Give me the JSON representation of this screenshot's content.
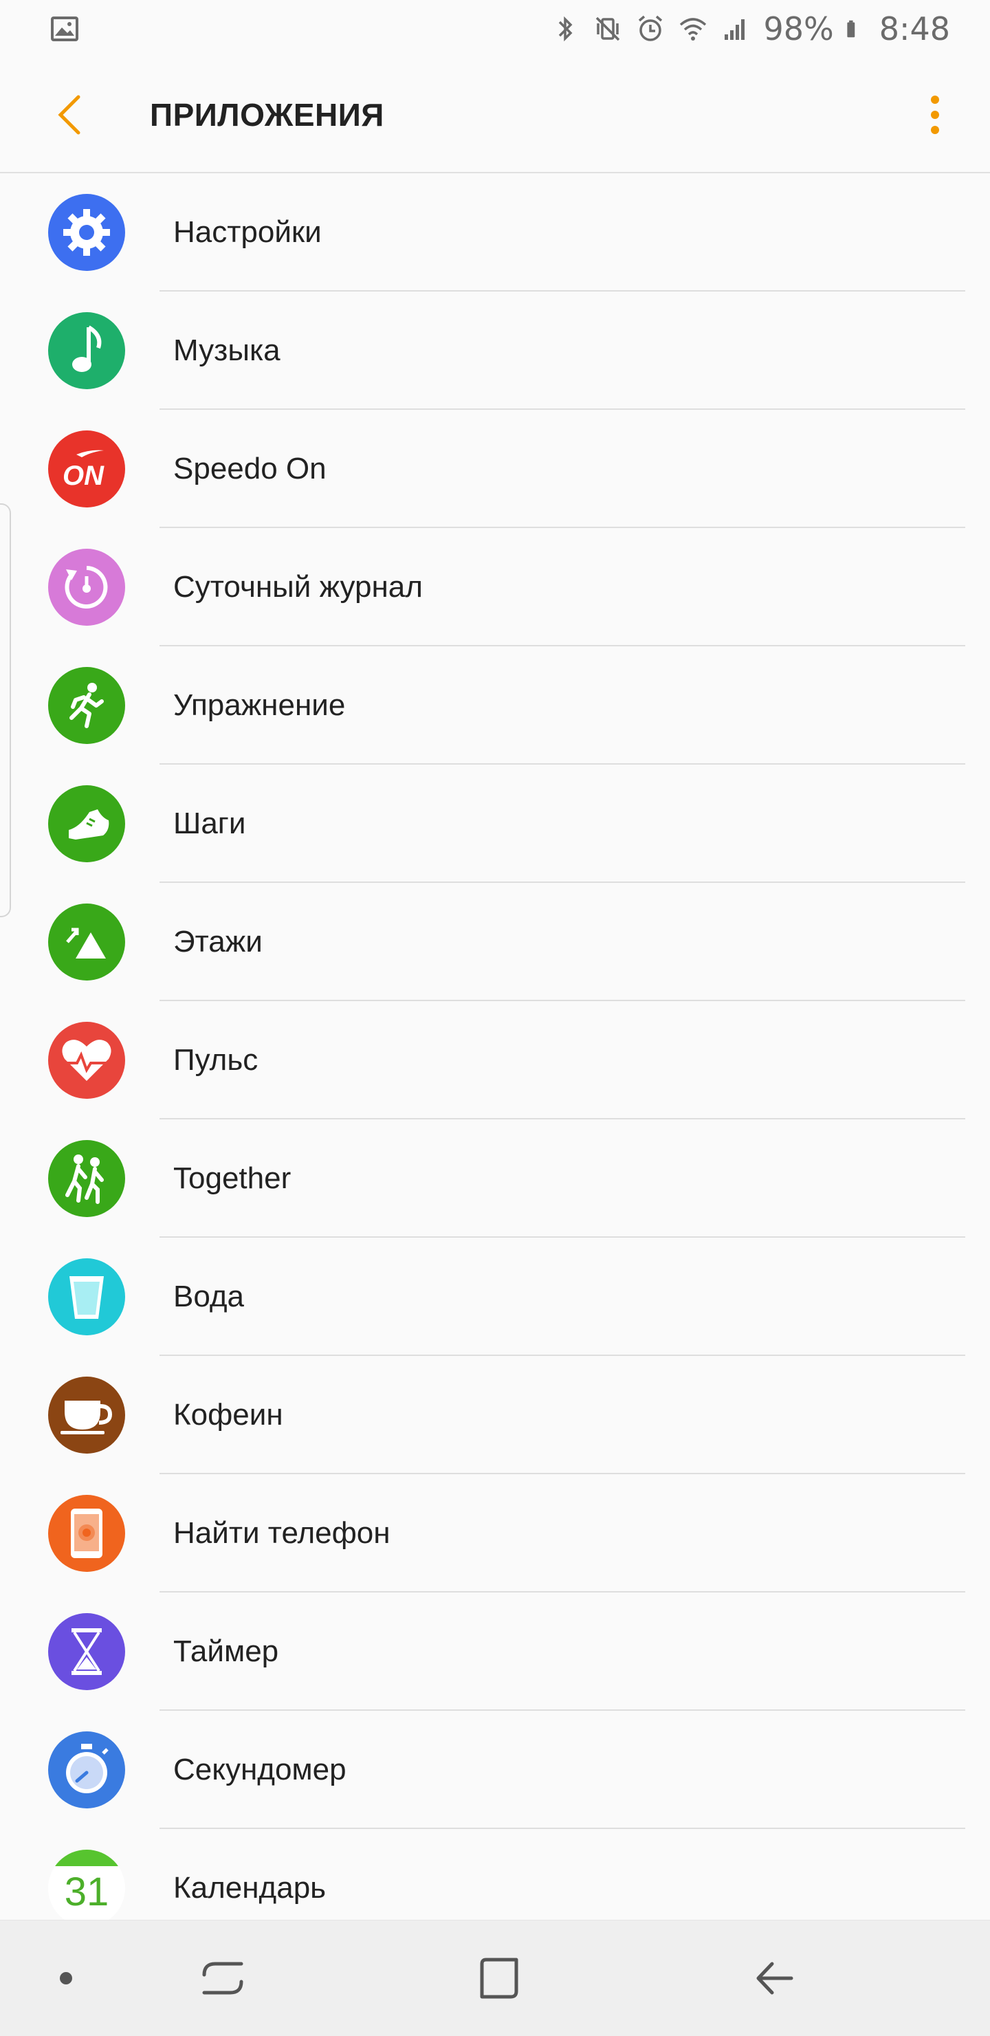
{
  "status_bar": {
    "battery_percent": "98%",
    "time": "8:48",
    "icons": [
      "image-icon",
      "bluetooth-icon",
      "vibrate-icon",
      "alarm-icon",
      "wifi-icon",
      "signal-icon",
      "battery-icon"
    ]
  },
  "header": {
    "title": "ПРИЛОЖЕНИЯ",
    "accent_color": "#f29900"
  },
  "apps": [
    {
      "label": "Настройки",
      "icon": "settings-gear-icon",
      "color": "#3d6ff0"
    },
    {
      "label": "Музыка",
      "icon": "music-note-icon",
      "color": "#1eaf6b"
    },
    {
      "label": "Speedo On",
      "icon": "speedo-on-icon",
      "color": "#e8332a"
    },
    {
      "label": "Суточный журнал",
      "icon": "daily-log-icon",
      "color": "#d77ad8"
    },
    {
      "label": "Упражнение",
      "icon": "runner-icon",
      "color": "#39a819"
    },
    {
      "label": "Шаги",
      "icon": "shoe-icon",
      "color": "#39a819"
    },
    {
      "label": "Этажи",
      "icon": "floors-icon",
      "color": "#39a819"
    },
    {
      "label": "Пульс",
      "icon": "heart-rate-icon",
      "color": "#e8453c"
    },
    {
      "label": "Together",
      "icon": "together-icon",
      "color": "#39a819"
    },
    {
      "label": "Вода",
      "icon": "water-glass-icon",
      "color": "#21c9d7"
    },
    {
      "label": "Кофеин",
      "icon": "coffee-cup-icon",
      "color": "#8b4513"
    },
    {
      "label": "Найти телефон",
      "icon": "find-phone-icon",
      "color": "#f0641e"
    },
    {
      "label": "Таймер",
      "icon": "hourglass-icon",
      "color": "#6a4fe0"
    },
    {
      "label": "Секундомер",
      "icon": "stopwatch-icon",
      "color": "#3a7be0"
    },
    {
      "label": "Календарь",
      "icon": "calendar-icon",
      "color": "#ffffff",
      "day": "31"
    }
  ]
}
